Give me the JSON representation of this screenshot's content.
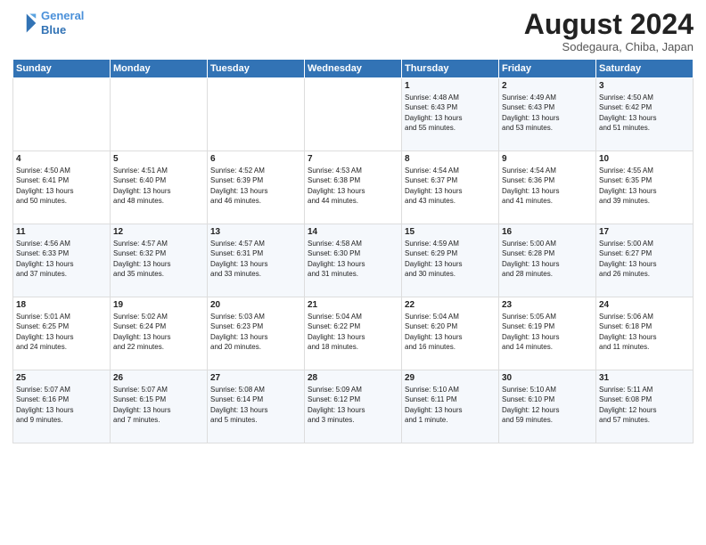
{
  "header": {
    "logo_line1": "General",
    "logo_line2": "Blue",
    "main_title": "August 2024",
    "subtitle": "Sodegaura, Chiba, Japan"
  },
  "days_of_week": [
    "Sunday",
    "Monday",
    "Tuesday",
    "Wednesday",
    "Thursday",
    "Friday",
    "Saturday"
  ],
  "weeks": [
    [
      {
        "day": "",
        "content": ""
      },
      {
        "day": "",
        "content": ""
      },
      {
        "day": "",
        "content": ""
      },
      {
        "day": "",
        "content": ""
      },
      {
        "day": "1",
        "content": "Sunrise: 4:48 AM\nSunset: 6:43 PM\nDaylight: 13 hours\nand 55 minutes."
      },
      {
        "day": "2",
        "content": "Sunrise: 4:49 AM\nSunset: 6:43 PM\nDaylight: 13 hours\nand 53 minutes."
      },
      {
        "day": "3",
        "content": "Sunrise: 4:50 AM\nSunset: 6:42 PM\nDaylight: 13 hours\nand 51 minutes."
      }
    ],
    [
      {
        "day": "4",
        "content": "Sunrise: 4:50 AM\nSunset: 6:41 PM\nDaylight: 13 hours\nand 50 minutes."
      },
      {
        "day": "5",
        "content": "Sunrise: 4:51 AM\nSunset: 6:40 PM\nDaylight: 13 hours\nand 48 minutes."
      },
      {
        "day": "6",
        "content": "Sunrise: 4:52 AM\nSunset: 6:39 PM\nDaylight: 13 hours\nand 46 minutes."
      },
      {
        "day": "7",
        "content": "Sunrise: 4:53 AM\nSunset: 6:38 PM\nDaylight: 13 hours\nand 44 minutes."
      },
      {
        "day": "8",
        "content": "Sunrise: 4:54 AM\nSunset: 6:37 PM\nDaylight: 13 hours\nand 43 minutes."
      },
      {
        "day": "9",
        "content": "Sunrise: 4:54 AM\nSunset: 6:36 PM\nDaylight: 13 hours\nand 41 minutes."
      },
      {
        "day": "10",
        "content": "Sunrise: 4:55 AM\nSunset: 6:35 PM\nDaylight: 13 hours\nand 39 minutes."
      }
    ],
    [
      {
        "day": "11",
        "content": "Sunrise: 4:56 AM\nSunset: 6:33 PM\nDaylight: 13 hours\nand 37 minutes."
      },
      {
        "day": "12",
        "content": "Sunrise: 4:57 AM\nSunset: 6:32 PM\nDaylight: 13 hours\nand 35 minutes."
      },
      {
        "day": "13",
        "content": "Sunrise: 4:57 AM\nSunset: 6:31 PM\nDaylight: 13 hours\nand 33 minutes."
      },
      {
        "day": "14",
        "content": "Sunrise: 4:58 AM\nSunset: 6:30 PM\nDaylight: 13 hours\nand 31 minutes."
      },
      {
        "day": "15",
        "content": "Sunrise: 4:59 AM\nSunset: 6:29 PM\nDaylight: 13 hours\nand 30 minutes."
      },
      {
        "day": "16",
        "content": "Sunrise: 5:00 AM\nSunset: 6:28 PM\nDaylight: 13 hours\nand 28 minutes."
      },
      {
        "day": "17",
        "content": "Sunrise: 5:00 AM\nSunset: 6:27 PM\nDaylight: 13 hours\nand 26 minutes."
      }
    ],
    [
      {
        "day": "18",
        "content": "Sunrise: 5:01 AM\nSunset: 6:25 PM\nDaylight: 13 hours\nand 24 minutes."
      },
      {
        "day": "19",
        "content": "Sunrise: 5:02 AM\nSunset: 6:24 PM\nDaylight: 13 hours\nand 22 minutes."
      },
      {
        "day": "20",
        "content": "Sunrise: 5:03 AM\nSunset: 6:23 PM\nDaylight: 13 hours\nand 20 minutes."
      },
      {
        "day": "21",
        "content": "Sunrise: 5:04 AM\nSunset: 6:22 PM\nDaylight: 13 hours\nand 18 minutes."
      },
      {
        "day": "22",
        "content": "Sunrise: 5:04 AM\nSunset: 6:20 PM\nDaylight: 13 hours\nand 16 minutes."
      },
      {
        "day": "23",
        "content": "Sunrise: 5:05 AM\nSunset: 6:19 PM\nDaylight: 13 hours\nand 14 minutes."
      },
      {
        "day": "24",
        "content": "Sunrise: 5:06 AM\nSunset: 6:18 PM\nDaylight: 13 hours\nand 11 minutes."
      }
    ],
    [
      {
        "day": "25",
        "content": "Sunrise: 5:07 AM\nSunset: 6:16 PM\nDaylight: 13 hours\nand 9 minutes."
      },
      {
        "day": "26",
        "content": "Sunrise: 5:07 AM\nSunset: 6:15 PM\nDaylight: 13 hours\nand 7 minutes."
      },
      {
        "day": "27",
        "content": "Sunrise: 5:08 AM\nSunset: 6:14 PM\nDaylight: 13 hours\nand 5 minutes."
      },
      {
        "day": "28",
        "content": "Sunrise: 5:09 AM\nSunset: 6:12 PM\nDaylight: 13 hours\nand 3 minutes."
      },
      {
        "day": "29",
        "content": "Sunrise: 5:10 AM\nSunset: 6:11 PM\nDaylight: 13 hours\nand 1 minute."
      },
      {
        "day": "30",
        "content": "Sunrise: 5:10 AM\nSunset: 6:10 PM\nDaylight: 12 hours\nand 59 minutes."
      },
      {
        "day": "31",
        "content": "Sunrise: 5:11 AM\nSunset: 6:08 PM\nDaylight: 12 hours\nand 57 minutes."
      }
    ]
  ]
}
